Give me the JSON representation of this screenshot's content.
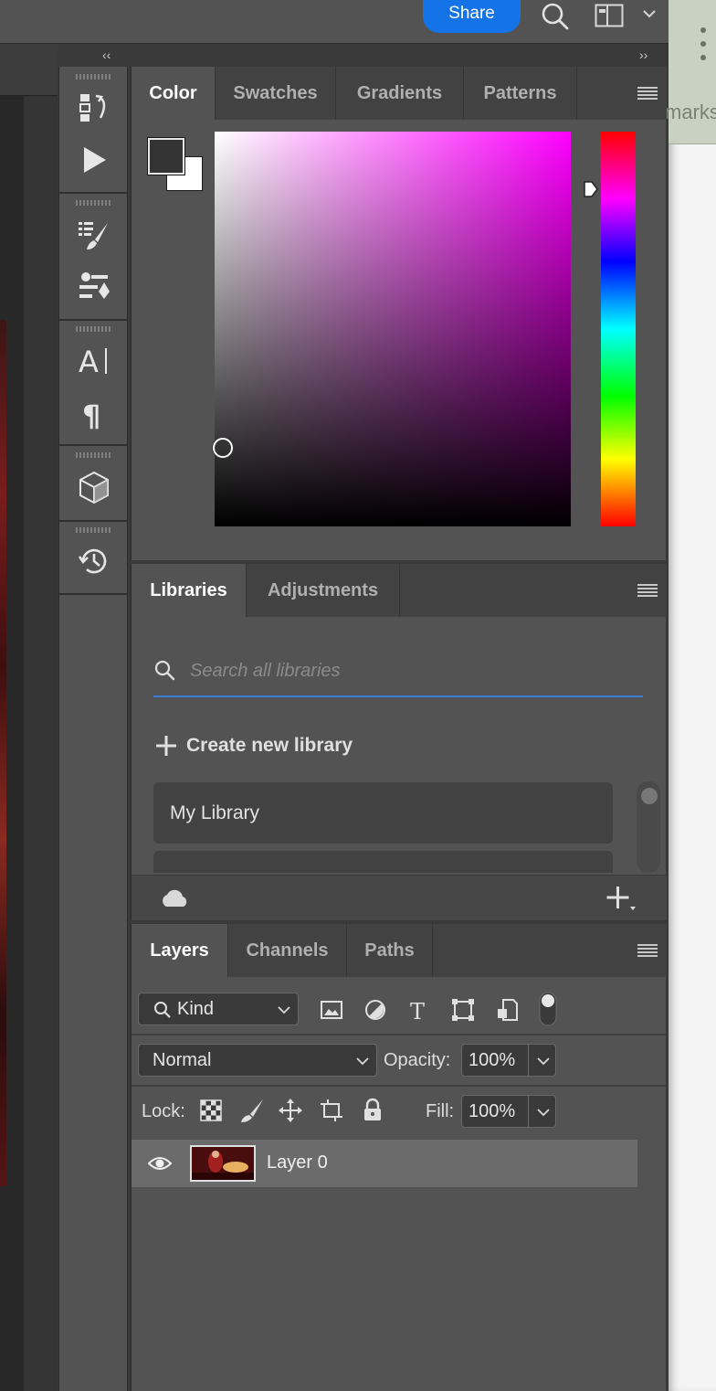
{
  "topbar": {
    "share_label": "Share",
    "icons": [
      "search-icon",
      "workspace-icon",
      "chevron-down-icon"
    ]
  },
  "browser": {
    "partial_text": "marks"
  },
  "color_panel": {
    "tabs": [
      {
        "label": "Color",
        "active": true
      },
      {
        "label": "Swatches",
        "active": false
      },
      {
        "label": "Gradients",
        "active": false
      },
      {
        "label": "Patterns",
        "active": false
      }
    ],
    "foreground_color": "#333333",
    "background_color": "#ffffff",
    "hue_color": "#ff00ff"
  },
  "libraries_panel": {
    "tabs": [
      {
        "label": "Libraries",
        "active": true
      },
      {
        "label": "Adjustments",
        "active": false
      }
    ],
    "search_placeholder": "Search all libraries",
    "create_label": "Create new library",
    "items": [
      "My Library"
    ]
  },
  "layers_panel": {
    "tabs": [
      {
        "label": "Layers",
        "active": true
      },
      {
        "label": "Channels",
        "active": false
      },
      {
        "label": "Paths",
        "active": false
      }
    ],
    "filter_kind": "Kind",
    "blend_mode": "Normal",
    "opacity_label": "Opacity:",
    "opacity_value": "100%",
    "lock_label": "Lock:",
    "fill_label": "Fill:",
    "fill_value": "100%",
    "layers": [
      {
        "name": "Layer 0",
        "visible": true
      }
    ]
  },
  "colors": {
    "accent": "#1473e6",
    "panel_bg": "#535353",
    "tab_bg": "#424242"
  }
}
